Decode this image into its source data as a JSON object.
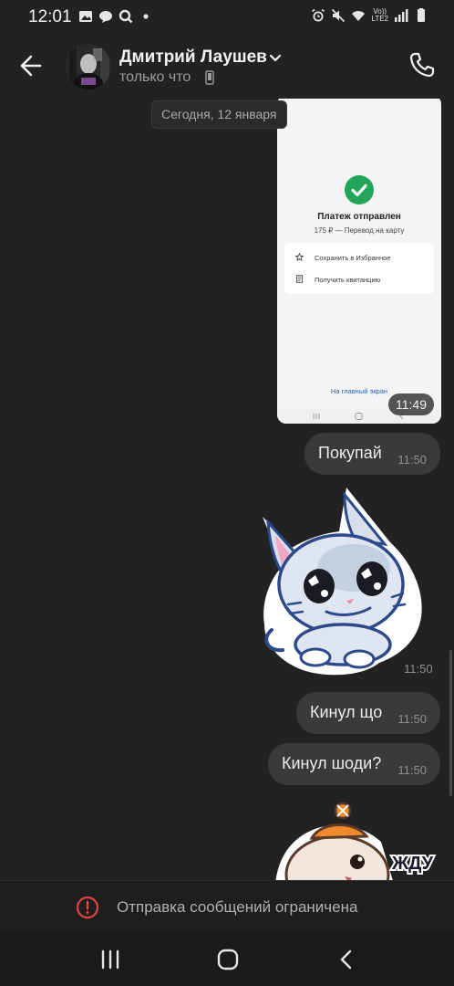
{
  "status_bar": {
    "time": "12:01",
    "left_icons": [
      "image-icon",
      "chat-icon",
      "search-ring-icon",
      "dot-icon"
    ],
    "right_icons": [
      "alarm-icon",
      "mute-icon",
      "wifi-icon",
      "signal-icon",
      "battery-icon"
    ],
    "network_label_top": "Vo))",
    "network_label_bottom": "LTE2"
  },
  "header": {
    "contact_name": "Дмитрий Лаушев",
    "status": "только что",
    "accent_color": "#ffffff"
  },
  "chat": {
    "date_label": "Сегодня, 12 января",
    "image_message": {
      "title": "Платеж отправлен",
      "subtitle": "175 ₽ — Перевод на карту",
      "actions": [
        "Сохранить в Избранное",
        "Получить квитанцию"
      ],
      "home_link": "На главный экран",
      "time": "11:49",
      "check_color": "#23a55a"
    },
    "messages": [
      {
        "text": "Покупай",
        "time": "11:50"
      },
      {
        "text": "Кинул що",
        "time": "11:50"
      },
      {
        "text": "Кинул шоди?",
        "time": "11:50"
      }
    ],
    "sticker_cat": {
      "time": "11:50"
    },
    "sticker_hamster": {
      "caption": "ЖДУ"
    }
  },
  "footer": {
    "restriction_text": "Отправка сообщений ограничена",
    "warning_color": "#e0433d"
  },
  "system_nav": {
    "buttons": [
      "recents-icon",
      "home-icon",
      "back-icon"
    ]
  }
}
